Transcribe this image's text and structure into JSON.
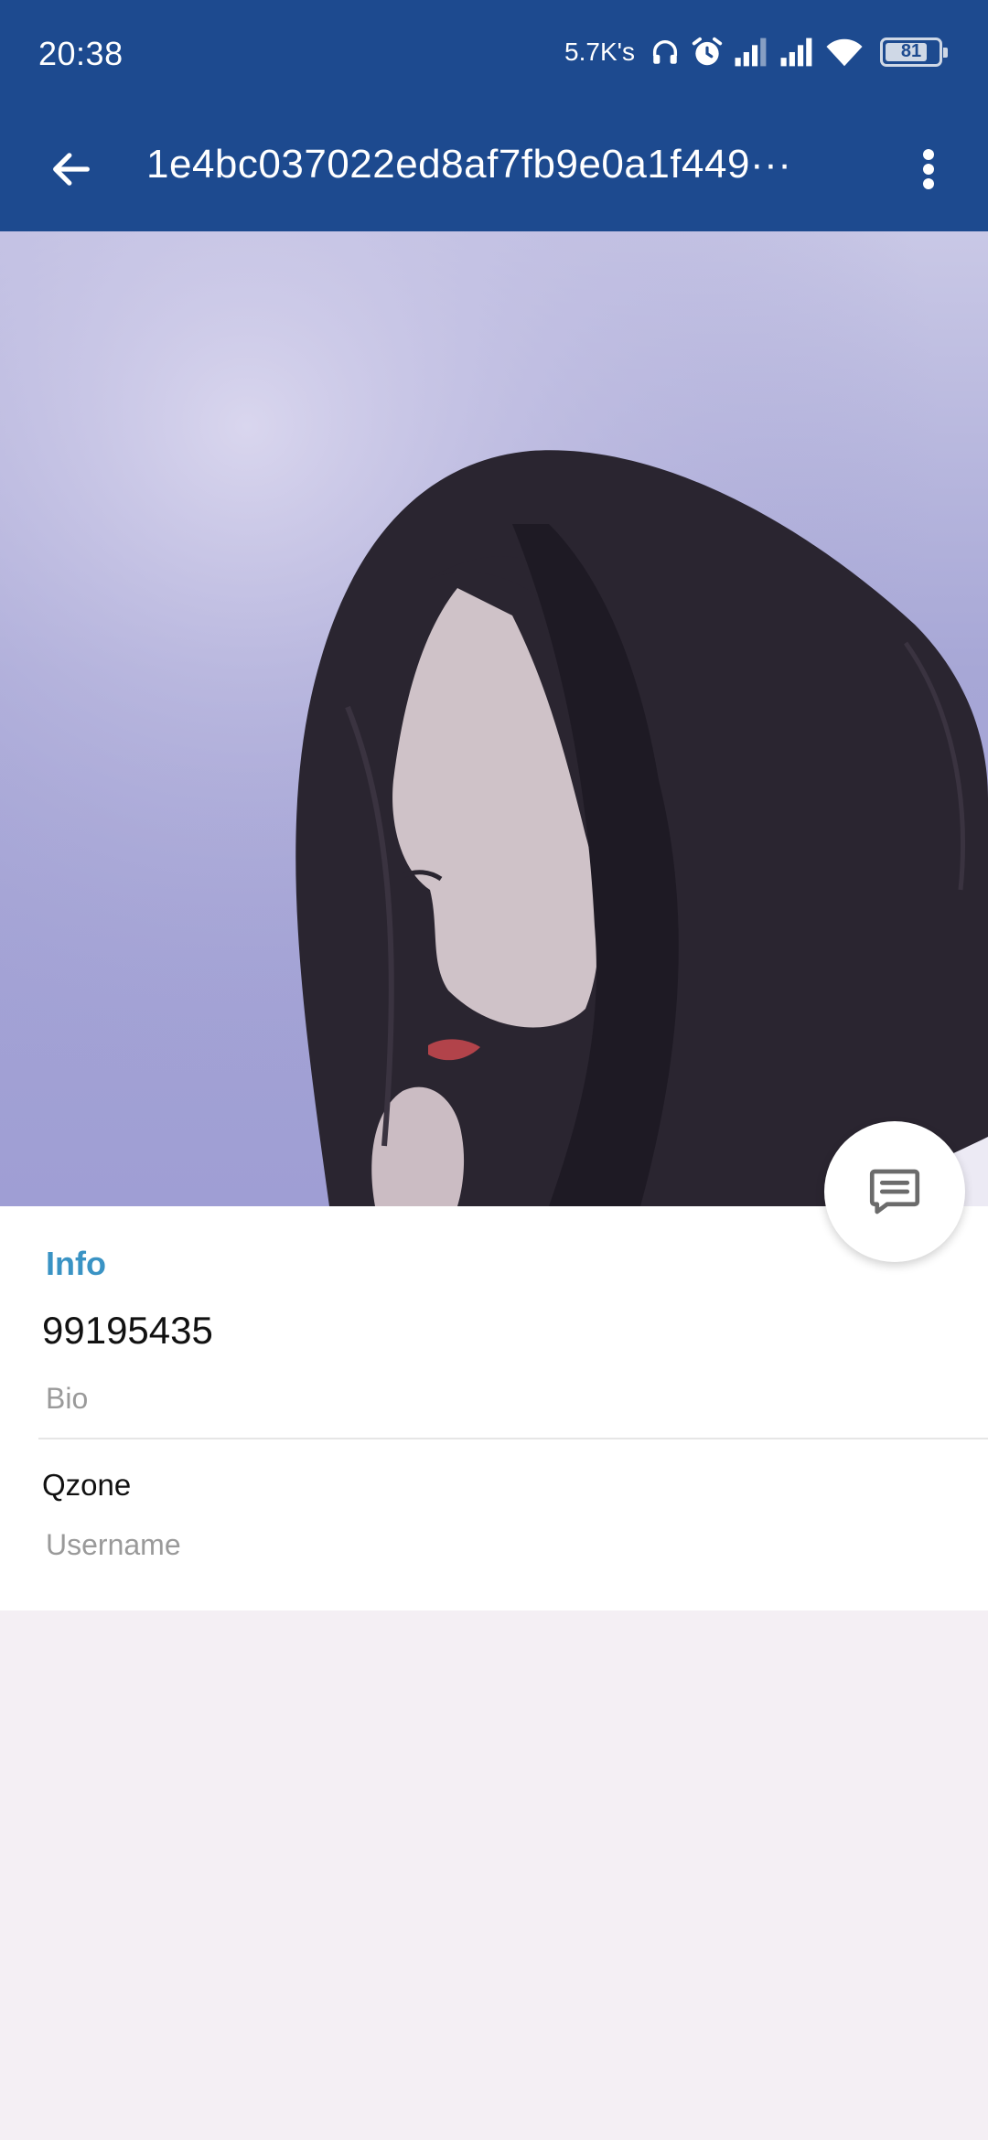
{
  "status_bar": {
    "time": "20:38",
    "net_speed": "5.7K's",
    "battery_level": "81",
    "battery_fraction": 0.81,
    "icons": [
      "headphones-icon",
      "alarm-icon",
      "signal-icon",
      "signal-icon",
      "wifi-icon",
      "battery-icon"
    ]
  },
  "app_bar": {
    "title": "1e4bc037022ed8af7fb9e0a1f449···",
    "back_icon": "arrow-left-icon",
    "menu_icon": "more-vert-icon",
    "background": "#1d4a8f"
  },
  "fab": {
    "icon": "message-icon"
  },
  "info": {
    "heading": "Info",
    "id_value": "99195435",
    "id_label": "Bio",
    "qzone_value": "Qzone",
    "qzone_label": "Username",
    "accent": "#3a93c4"
  }
}
